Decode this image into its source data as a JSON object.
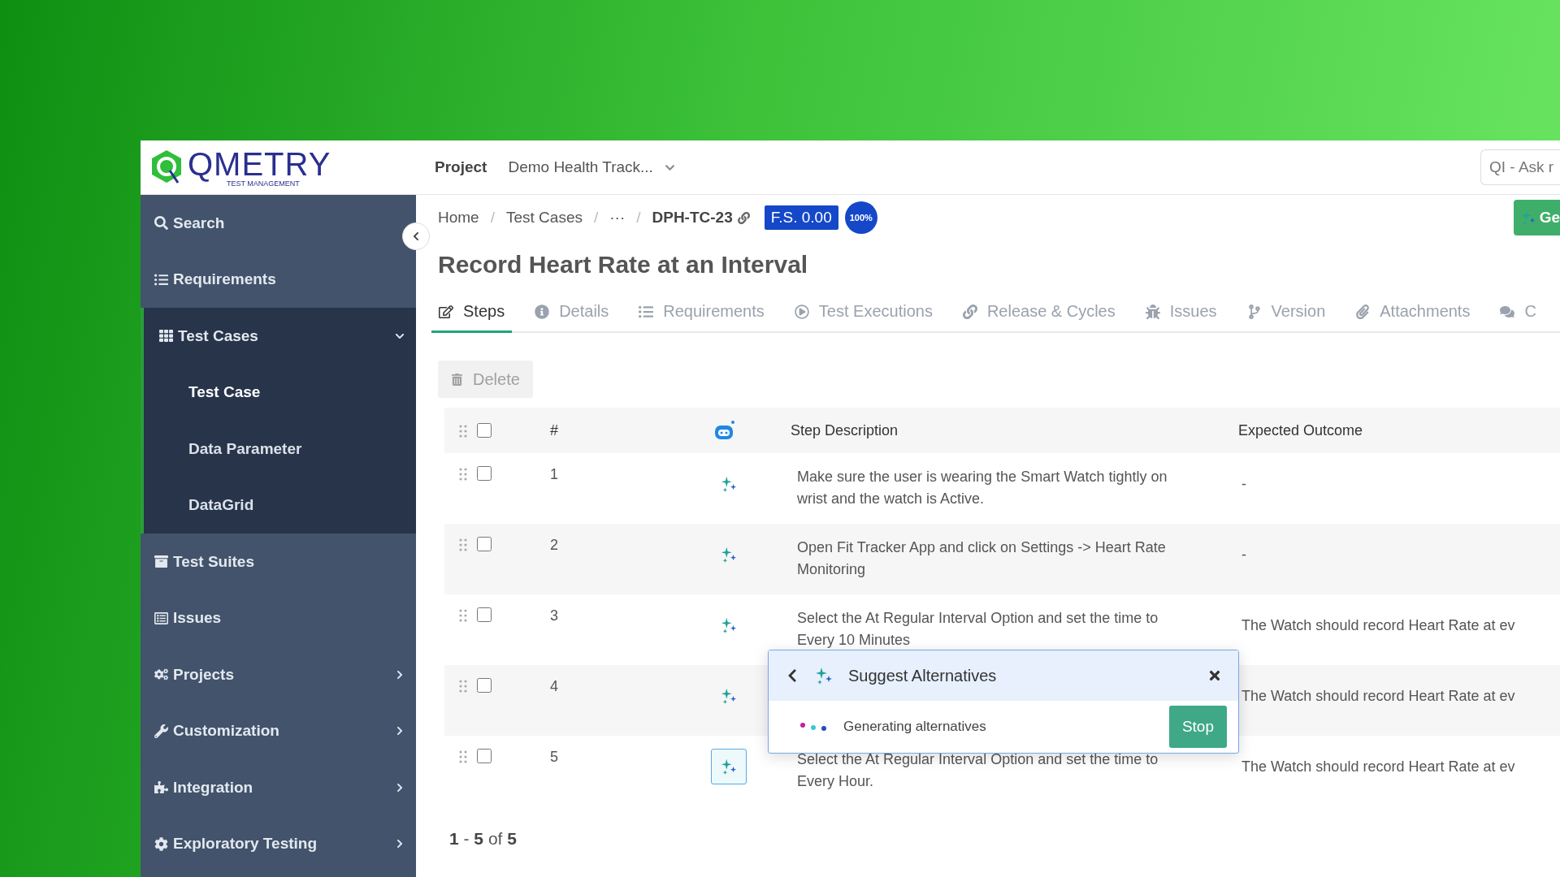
{
  "header": {
    "logo": {
      "name": "QMETRY",
      "tagline": "TEST MANAGEMENT"
    },
    "project_label": "Project",
    "project_value": "Demo Health Track...",
    "search": {
      "placeholder": "QI - Ask r"
    }
  },
  "sidebar": {
    "items": [
      {
        "label": "Search",
        "expandable": false,
        "expanded": false
      },
      {
        "label": "Requirements",
        "expandable": false,
        "expanded": false
      },
      {
        "label": "Test Cases",
        "expandable": true,
        "expanded": true,
        "children": [
          {
            "label": "Test Case",
            "selected": true
          },
          {
            "label": "Data Parameter",
            "selected": false
          },
          {
            "label": "DataGrid",
            "selected": false
          }
        ]
      },
      {
        "label": "Test Suites",
        "expandable": false,
        "expanded": false
      },
      {
        "label": "Issues",
        "expandable": false,
        "expanded": false
      },
      {
        "label": "Projects",
        "expandable": true,
        "expanded": false
      },
      {
        "label": "Customization",
        "expandable": true,
        "expanded": false
      },
      {
        "label": "Integration",
        "expandable": true,
        "expanded": false
      },
      {
        "label": "Exploratory Testing",
        "expandable": true,
        "expanded": false
      }
    ]
  },
  "breadcrumb": [
    "Home",
    "Test Cases",
    "···",
    "DPH-TC-23"
  ],
  "breadcrumb_separator": "/",
  "badges": {
    "score": "F.S. 0.00",
    "percent": "100%"
  },
  "generate_button": "Ge",
  "title": "Record Heart Rate at an Interval",
  "tabs": [
    {
      "label": "Steps",
      "selected": true
    },
    {
      "label": "Details",
      "selected": false
    },
    {
      "label": "Requirements",
      "selected": false
    },
    {
      "label": "Test Executions",
      "selected": false
    },
    {
      "label": "Release & Cycles",
      "selected": false
    },
    {
      "label": "Issues",
      "selected": false
    },
    {
      "label": "Version",
      "selected": false
    },
    {
      "label": "Attachments",
      "selected": false
    },
    {
      "label": "C",
      "selected": false
    }
  ],
  "delete_button": {
    "label": "Delete",
    "disabled": true
  },
  "table": {
    "checked": false,
    "columns": [
      "#",
      "Step Description",
      "Expected Outcome"
    ],
    "rows": [
      {
        "number": "1",
        "description": "Make sure the user is wearing the Smart Watch tightly on wrist and the watch is Active.",
        "outcome": "-",
        "checked": false,
        "active": false
      },
      {
        "number": "2",
        "description": "Open Fit Tracker App and click on Settings -> Heart Rate Monitoring",
        "outcome": "-",
        "checked": false,
        "active": false
      },
      {
        "number": "3",
        "description": "Select the At Regular Interval Option and set the time to Every 10 Minutes",
        "outcome": "The Watch should record Heart Rate at ev",
        "checked": false,
        "active": false
      },
      {
        "number": "4",
        "outcome": "The Watch should record Heart Rate at ev",
        "checked": false,
        "active": false
      },
      {
        "number": "5",
        "description": "Select the At Regular Interval Option and set the time to Every Hour.",
        "outcome": "The Watch should record Heart Rate at ev",
        "checked": false,
        "active": true
      }
    ]
  },
  "pagination": "**1** - **5** of **5**",
  "popup": {
    "title": "Suggest Alternatives",
    "status": "Generating alternatives",
    "button": "Stop"
  }
}
